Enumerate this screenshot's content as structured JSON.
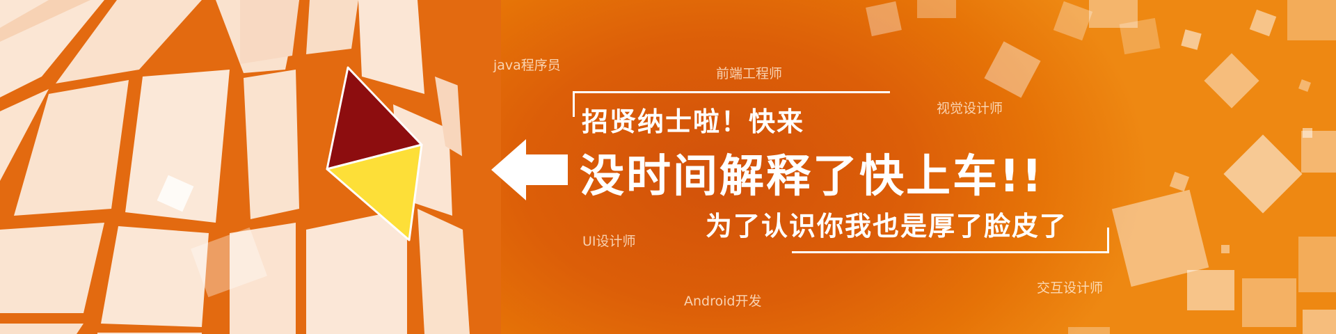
{
  "colors": {
    "orange_dark": "#d2520a",
    "orange_light": "#ee8812",
    "cream": "#fbe6d4",
    "maroon": "#8d0d0f",
    "yellow": "#fddf38",
    "white": "#ffffff"
  },
  "headline": {
    "line1": "招贤纳士啦！快来",
    "line2": "没时间解释了快上车!!",
    "line3": "为了认识你我也是厚了脸皮了"
  },
  "jobs": [
    {
      "id": "java",
      "label": "java程序员"
    },
    {
      "id": "frontend",
      "label": "前端工程师"
    },
    {
      "id": "visual",
      "label": "视觉设计师"
    },
    {
      "id": "ui",
      "label": "UI设计师"
    },
    {
      "id": "interaction",
      "label": "交互设计师"
    },
    {
      "id": "android",
      "label": "Android开发"
    }
  ],
  "icons": {
    "arrow": "arrow-left-icon",
    "cube": "cube-graphic",
    "triangle": "triangle-graphic"
  }
}
